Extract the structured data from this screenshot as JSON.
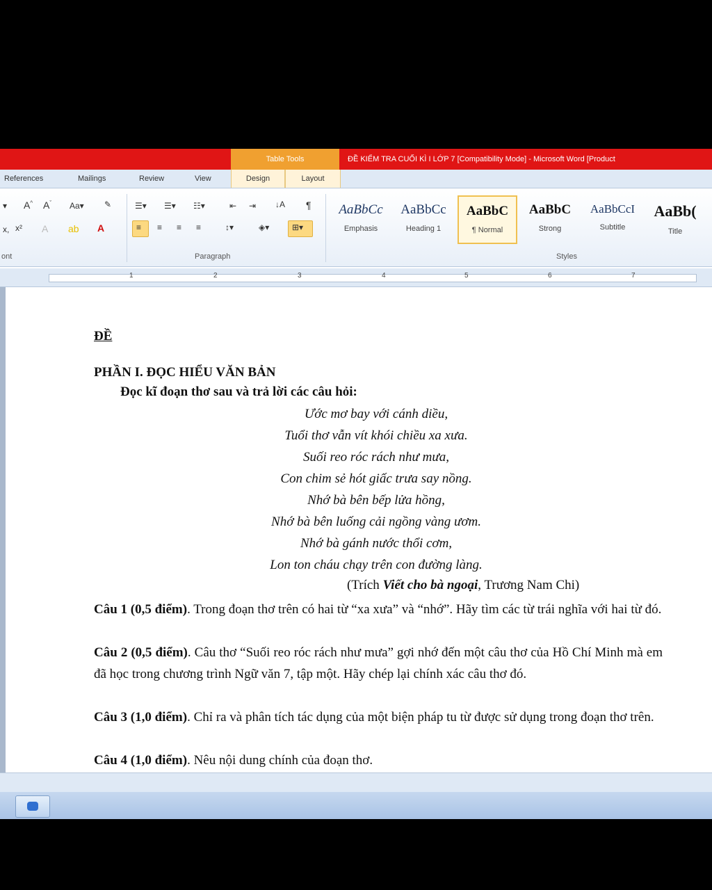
{
  "titlebar": {
    "context_tab": "Table Tools",
    "title": "ĐỀ KIỂM TRA CUỐI KÌ I LỚP 7 [Compatibility Mode] - Microsoft Word [Product"
  },
  "ribbon_tabs": [
    "References",
    "Mailings",
    "Review",
    "View",
    "Design",
    "Layout"
  ],
  "ribbon": {
    "font_group_label": "ont",
    "paragraph_group_label": "Paragraph",
    "styles_group_label": "Styles",
    "styles": [
      {
        "sample": "AaBbCc",
        "name": "Emphasis"
      },
      {
        "sample": "AaBbCc",
        "name": "Heading 1"
      },
      {
        "sample": "AaBbC",
        "name": "¶ Normal"
      },
      {
        "sample": "AaBbC",
        "name": "Strong"
      },
      {
        "sample": "AaBbCcI",
        "name": "Subtitle"
      },
      {
        "sample": "AaBb(",
        "name": "Title"
      }
    ]
  },
  "ruler_numbers": [
    "1",
    "2",
    "3",
    "4",
    "5",
    "6",
    "7"
  ],
  "document": {
    "heading": "ĐỀ",
    "section": "PHẦN I. ĐỌC HIỂU VĂN BẢN",
    "instruction": "Đọc kĩ đoạn thơ sau và trả lời các câu hỏi:",
    "poem": [
      "Ước mơ bay với cánh diều,",
      "Tuổi thơ vẫn vít khói chiều xa xưa.",
      "Suối reo róc rách như mưa,",
      "Con chim sẻ hót giấc trưa say nồng.",
      "Nhớ bà bên bếp lửa hồng,",
      "Nhớ bà bên luống cải ngồng vàng ươm.",
      "Nhớ bà gánh nước thổi cơm,",
      "Lon ton cháu chạy trên con đường làng."
    ],
    "source_prefix": "(Trích ",
    "source_title": "Viết cho bà ngoại",
    "source_suffix": ", Trương Nam Chi)",
    "questions": [
      {
        "label": "Câu 1 (0,5 điểm)",
        "text": ". Trong đoạn thơ trên có hai từ “xa xưa” và “nhớ”. Hãy tìm các từ trái nghĩa với hai từ đó."
      },
      {
        "label": "Câu 2 (0,5 điểm)",
        "text": ". Câu thơ “Suối reo róc rách như mưa” gợi nhớ đến một câu thơ của Hồ Chí Minh mà em đã học trong chương trình Ngữ văn 7, tập một. Hãy chép lại chính xác câu thơ đó."
      },
      {
        "label": "Câu 3 (1,0 điểm)",
        "text": ". Chỉ ra và phân tích tác dụng của một biện pháp tu từ được sử dụng trong đoạn thơ trên."
      },
      {
        "label": "Câu 4 (1,0 điểm)",
        "text": ". Nêu nội dung chính của đoạn thơ."
      }
    ]
  }
}
